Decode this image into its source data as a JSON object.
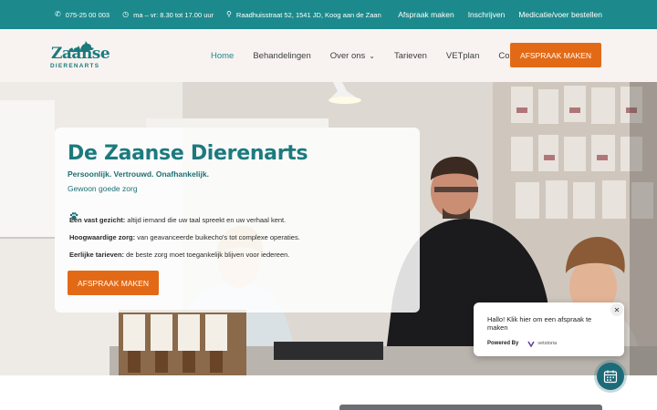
{
  "topbar": {
    "phone": "075-25 00 003",
    "hours": "ma – vr: 8.30 tot 17.00 uur",
    "address": "Raadhuisstraat 52, 1541 JD, Koog aan de Zaan",
    "links": [
      "Afspraak maken",
      "Inschrijven",
      "Medicatie/voer bestellen"
    ]
  },
  "logo": {
    "line1": "Zaanse",
    "line2": "DIERENARTS"
  },
  "nav": {
    "items": [
      "Home",
      "Behandelingen",
      "Over ons",
      "Tarieven",
      "VETplan",
      "Contact"
    ],
    "active": "Home",
    "dropdown_mark": "⌄"
  },
  "cta_top": "AFSPRAAK MAKEN",
  "hero": {
    "title": "De Zaanse Dierenarts",
    "tagline": "Persoonlijk. Vertrouwd. Onafhankelijk.",
    "subtagline": "Gewoon goede zorg",
    "features": [
      {
        "bold": "Een vast gezicht:",
        "text": " altijd iemand die uw taal spreekt en uw verhaal kent."
      },
      {
        "bold": "Hoogwaardige zorg:",
        "text": " van geavanceerde buikecho's tot complexe operaties."
      },
      {
        "bold": "Eerlijke tarieven:",
        "text": " de beste zorg moet toegankelijk blijven voor iedereen."
      }
    ],
    "cta": "AFSPRAAK MAKEN"
  },
  "chat": {
    "message": "Hallo! Klik hier om een afspraak te maken",
    "powered_by": "Powered By",
    "brand": "vetstoria",
    "close": "✕"
  },
  "colors": {
    "teal": "#1c8a8d",
    "orange": "#e26a16",
    "header_bg": "#f8f3f1"
  },
  "icons": {
    "phone": "phone-icon",
    "clock": "clock-icon",
    "pin": "location-pin-icon",
    "paw": "paw-icon",
    "calendar": "calendar-icon"
  }
}
